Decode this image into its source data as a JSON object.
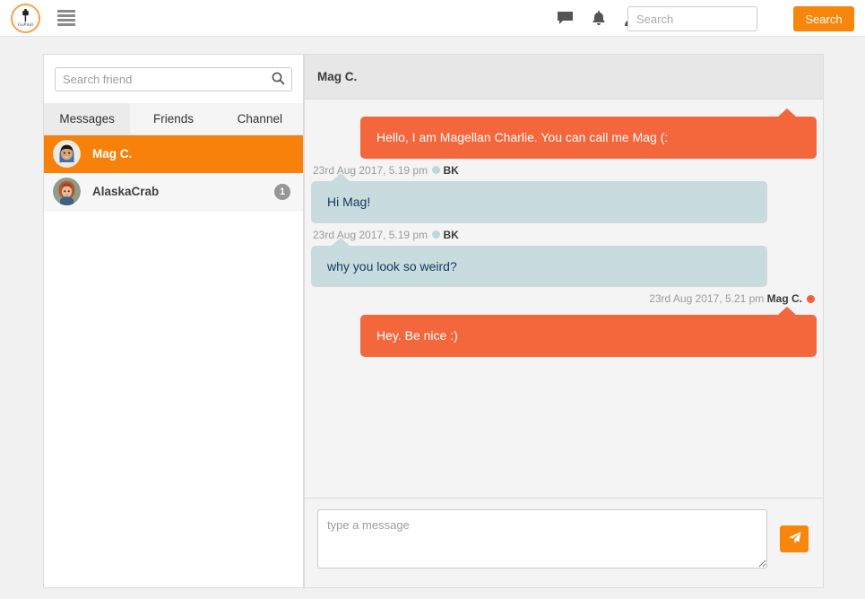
{
  "navbar": {
    "brand": {
      "icon": "pin-icon",
      "text": "GoPinIt"
    },
    "menu_icon": "hamburger-menu-icon",
    "icons": [
      {
        "name": "comment-icon"
      },
      {
        "name": "bell-icon"
      },
      {
        "name": "user-icon"
      }
    ],
    "search_placeholder": "Search",
    "search_value": "",
    "search_button": "Search"
  },
  "sidebar": {
    "search_placeholder": "Search friend",
    "search_value": "",
    "search_icon": "search-icon",
    "tabs": [
      {
        "label": "Messages",
        "active": true
      },
      {
        "label": "Friends",
        "active": false
      },
      {
        "label": "Channel",
        "active": false
      }
    ],
    "friends": [
      {
        "name": "Mag C.",
        "badge": "",
        "active": true
      },
      {
        "name": "AlaskaCrab",
        "badge": "1",
        "active": false
      }
    ]
  },
  "chat": {
    "header_title": "Mag C.",
    "messages": [
      {
        "side": "me",
        "text": "Hello, I am Magellan Charlie. You can call me Mag (:",
        "meta": null
      },
      {
        "side": "them",
        "text": "Hi Mag!",
        "meta": {
          "time": "23rd Aug 2017, 5.19 pm",
          "author": "BK"
        }
      },
      {
        "side": "them",
        "text": "why you look so weird?",
        "meta": {
          "time": "23rd Aug 2017, 5.19 pm",
          "author": "BK"
        }
      },
      {
        "side": "me",
        "text": "Hey. Be nice :)",
        "meta": {
          "time": "23rd Aug 2017, 5.21 pm",
          "author": "Mag C."
        }
      }
    ],
    "input_placeholder": "type a message",
    "input_value": "",
    "send_icon": "send-paper-plane-icon"
  },
  "colors": {
    "accent_orange": "#f7860b",
    "bubble_orange": "#f4663c",
    "bubble_blue": "#c8dcdf",
    "bubble_blue_text": "#16355c",
    "badge_gray": "#969696"
  }
}
